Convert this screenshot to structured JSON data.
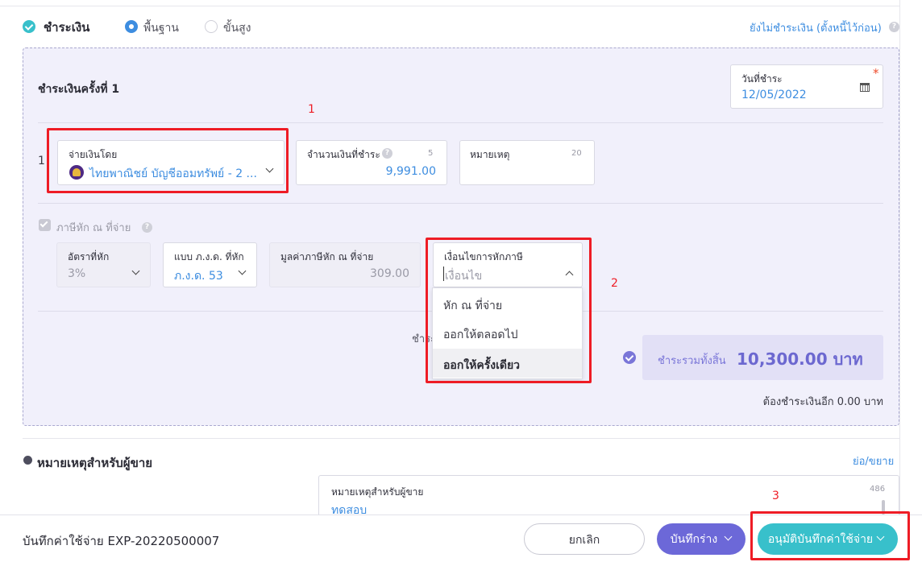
{
  "payment_header": {
    "title": "ชำระเงิน",
    "options": [
      {
        "label": "พื้นฐาน",
        "selected": true
      },
      {
        "label": "ขั้นสูง",
        "selected": false
      }
    ],
    "unpaid_link": "ยังไม่ชำระเงิน (ตั้งหนี้ไว้ก่อน)"
  },
  "round": {
    "title": "ชำระเงินครั้งที่ 1",
    "date_label": "วันที่ชำระ",
    "date_value": "12/05/2022",
    "required_mark": "*"
  },
  "payment_row": {
    "index": "1",
    "pay_by_label": "จ่ายเงินโดย",
    "pay_by_value": "ไทยพาณิชย์ บัญชีออมทรัพย์ - 2 ...",
    "amount_label": "จำนวนเงินที่ชำระ",
    "amount_count": "5",
    "amount_value": "9,991.00",
    "note_label": "หมายเหตุ",
    "note_count": "20"
  },
  "withholding": {
    "checkbox_label": "ภาษีหัก ณ ที่จ่าย",
    "rate_label": "อัตราที่หัก",
    "rate_value": "3%",
    "form_label": "แบบ ภ.ง.ด. ที่หัก",
    "form_value": "ภ.ง.ด. 53",
    "tax_value_label": "มูลค่าภาษีหัก ณ ที่จ่าย",
    "tax_value": "309.00",
    "condition_label": "เงื่อนไขการหักภาษี",
    "condition_placeholder": "เงื่อนไข",
    "condition_options": [
      "หัก ณ ที่จ่าย",
      "ออกให้ตลอดไป",
      "ออกให้ครั้งเดียว"
    ]
  },
  "summary": {
    "partial_label": "ชำระ",
    "total_label": "ชำระรวมทั้งสิ้น",
    "total_value": "10,300.00 บาท",
    "remaining": "ต้องชำระเงินอีก 0.00 บาท"
  },
  "seller_note": {
    "title": "หมายเหตุสำหรับผู้ขาย",
    "toggle": "ย่อ/ขยาย",
    "field_label": "หมายเหตุสำหรับผู้ขาย",
    "field_value": "ทดสอบ",
    "count": "486"
  },
  "footer": {
    "doc_title": "บันทึกค่าใช้จ่าย EXP-20220500007",
    "cancel": "ยกเลิก",
    "draft": "บันทึกร่าง",
    "approve": "อนุมัติบันทึกค่าใช้จ่าย"
  },
  "annotations": [
    "1",
    "2",
    "3"
  ],
  "colors": {
    "accent_blue": "#3d8de0",
    "teal": "#38c0cb",
    "purple": "#7a76d8",
    "panel_bg": "#f1f0fb",
    "highlight_red": "#ee1c25"
  }
}
